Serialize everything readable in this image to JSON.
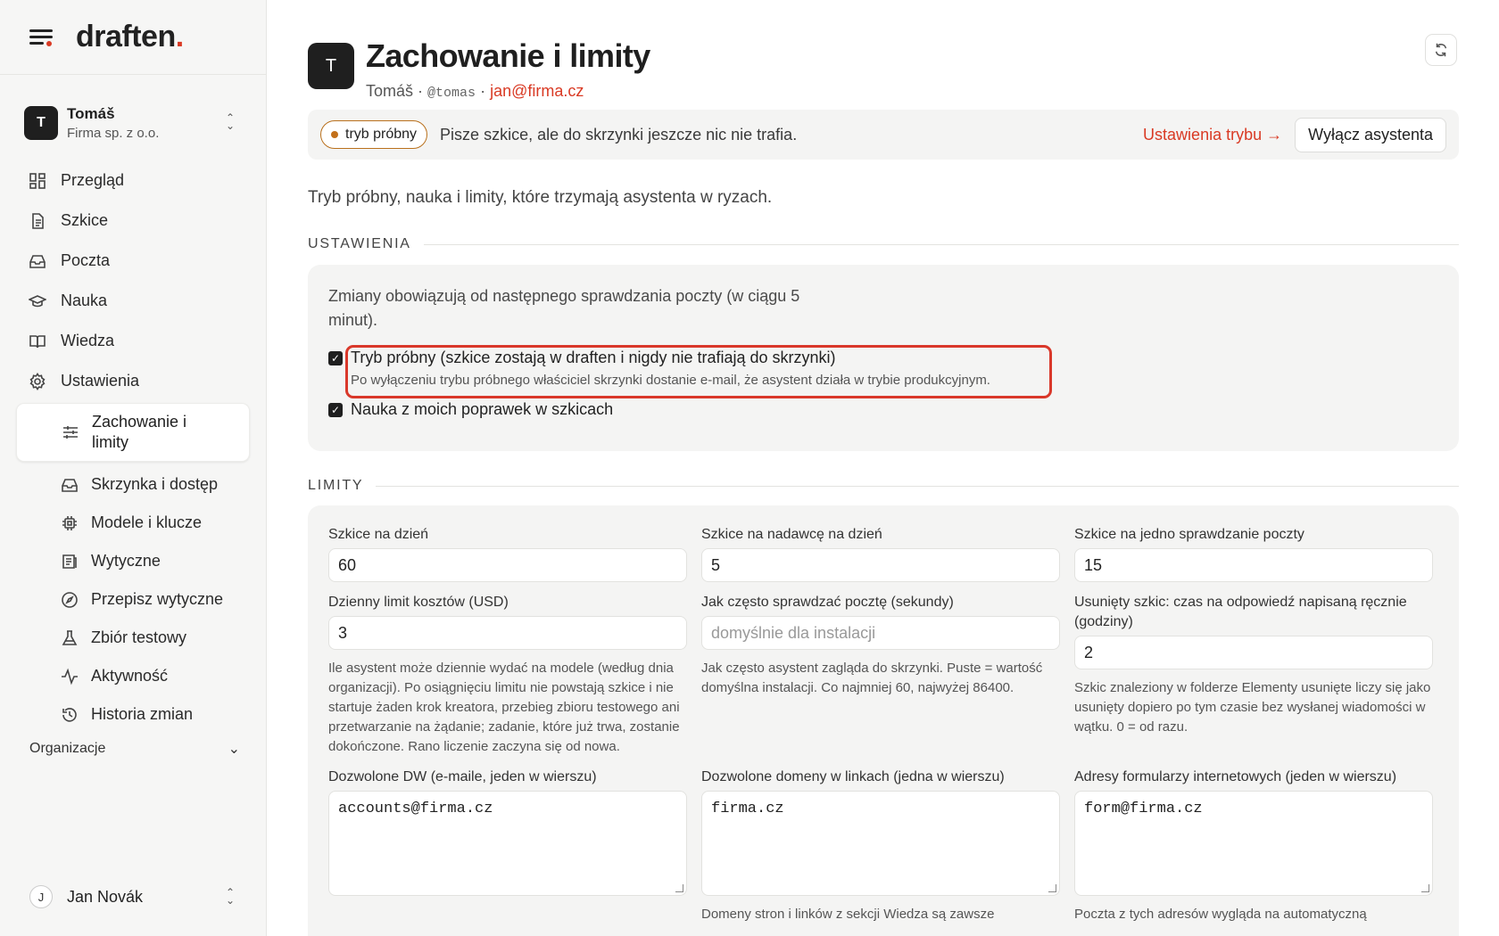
{
  "brand": {
    "name": "draften",
    "dot": "."
  },
  "account": {
    "initial": "T",
    "name": "Tomáš",
    "org": "Firma sp. z o.o."
  },
  "nav": {
    "items": [
      {
        "label": "Przegląd",
        "icon": "dashboard-icon"
      },
      {
        "label": "Szkice",
        "icon": "document-icon"
      },
      {
        "label": "Poczta",
        "icon": "inbox-icon"
      },
      {
        "label": "Nauka",
        "icon": "graduation-cap-icon"
      },
      {
        "label": "Wiedza",
        "icon": "book-icon"
      },
      {
        "label": "Ustawienia",
        "icon": "gear-icon"
      }
    ],
    "sub": [
      {
        "label": "Zachowanie i limity",
        "icon": "sliders-icon",
        "active": true
      },
      {
        "label": "Skrzynka i dostęp",
        "icon": "inbox-icon"
      },
      {
        "label": "Modele i klucze",
        "icon": "chip-icon"
      },
      {
        "label": "Wytyczne",
        "icon": "guidelines-icon"
      },
      {
        "label": "Przepisz wytyczne",
        "icon": "compass-icon"
      },
      {
        "label": "Zbiór testowy",
        "icon": "flask-icon"
      },
      {
        "label": "Aktywność",
        "icon": "activity-icon"
      },
      {
        "label": "Historia zmian",
        "icon": "history-icon"
      }
    ],
    "orgs_label": "Organizacje"
  },
  "user": {
    "initial": "J",
    "name": "Jan Novák"
  },
  "page": {
    "avatar": "T",
    "title": "Zachowanie i limity",
    "user_name": "Tomáš",
    "handle": "@tomas",
    "email": "jan@firma.cz",
    "sep": "·"
  },
  "banner": {
    "pill": "tryb próbny",
    "text": "Pisze szkice, ale do skrzynki jeszcze nic nie trafia.",
    "link": "Ustawienia trybu →",
    "button": "Wyłącz asystenta",
    "pill_color": "#c2701b"
  },
  "intro": "Tryb próbny, nauka i limity, które trzymają asystenta w ryzach.",
  "settings": {
    "heading": "USTAWIENIA",
    "note": "Zmiany obowiązują od następnego sprawdzania poczty (w ciągu 5 minut).",
    "dry_run": {
      "label": "Tryb próbny (szkice zostają w draften i nigdy nie trafiają do skrzynki)",
      "help": "Po wyłączeniu trybu próbnego właściciel skrzynki dostanie e-mail, że asystent działa w trybie produkcyjnym.",
      "checked": true
    },
    "learning": {
      "label": "Nauka z moich poprawek w szkicach",
      "checked": true
    }
  },
  "limits": {
    "heading": "LIMITY",
    "drafts_per_day": {
      "label": "Szkice na dzień",
      "value": "60"
    },
    "drafts_per_sender": {
      "label": "Szkice na nadawcę na dzień",
      "value": "5"
    },
    "drafts_per_check": {
      "label": "Szkice na jedno sprawdzanie poczty",
      "value": "15"
    },
    "cost_limit": {
      "label": "Dzienny limit kosztów (USD)",
      "value": "3",
      "help": "Ile asystent może dziennie wydać na modele (według dnia organizacji). Po osiągnięciu limitu nie powstają szkice i nie startuje żaden krok kreatora, przebieg zbioru testowego ani przetwarzanie na żądanie; zadanie, które już trwa, zostanie dokończone. Rano liczenie zaczyna się od nowa."
    },
    "poll_interval": {
      "label": "Jak często sprawdzać pocztę (sekundy)",
      "placeholder": "domyślnie dla instalacji",
      "help": "Jak często asystent zagląda do skrzynki. Puste = wartość domyślna instalacji. Co najmniej 60, najwyżej 86400."
    },
    "deleted_draft": {
      "label": "Usunięty szkic: czas na odpowiedź napisaną ręcznie (godziny)",
      "value": "2",
      "help": "Szkic znaleziony w folderze Elementy usunięte liczy się jako usunięty dopiero po tym czasie bez wysłanej wiadomości w wątku. 0 = od razu."
    },
    "allowed_cc": {
      "label": "Dozwolone DW (e-maile, jeden w wierszu)",
      "value": "accounts@firma.cz"
    },
    "allowed_domains": {
      "label": "Dozwolone domeny w linkach (jedna w wierszu)",
      "value": "firma.cz",
      "help": "Domeny stron i linków z sekcji Wiedza są zawsze"
    },
    "form_addresses": {
      "label": "Adresy formularzy internetowych (jeden w wierszu)",
      "value": "form@firma.cz",
      "help": "Poczta z tych adresów wygląda na automatyczną"
    }
  },
  "colors": {
    "accent": "#d93a24",
    "text": "#1f1f1f",
    "panel": "#f4f4f3"
  }
}
